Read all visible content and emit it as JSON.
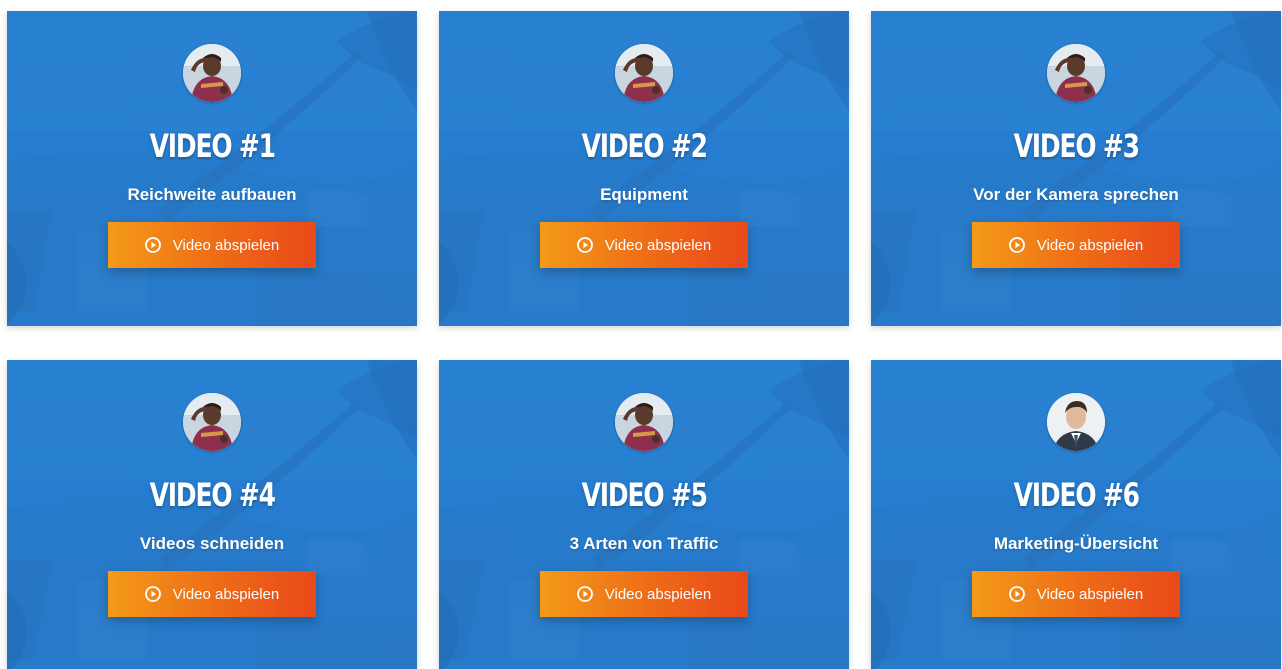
{
  "theme": {
    "card_blue": "#2378c8",
    "button_gradient_start": "#f39a17",
    "button_gradient_end": "#e8491a",
    "text_color": "#ffffff"
  },
  "cards": [
    {
      "title": "VIDEO #1",
      "subtitle": "Reichweite aufbauen",
      "button_label": "Video abspielen",
      "button_icon": "play-circle-icon",
      "avatar": "host-avatar"
    },
    {
      "title": "VIDEO #2",
      "subtitle": "Equipment",
      "button_label": "Video abspielen",
      "button_icon": "play-circle-icon",
      "avatar": "host-avatar"
    },
    {
      "title": "VIDEO #3",
      "subtitle": "Vor der Kamera sprechen",
      "button_label": "Video abspielen",
      "button_icon": "play-circle-icon",
      "avatar": "host-avatar"
    },
    {
      "title": "VIDEO #4",
      "subtitle": "Videos schneiden",
      "button_label": "Video abspielen",
      "button_icon": "play-circle-icon",
      "avatar": "host-avatar"
    },
    {
      "title": "VIDEO #5",
      "subtitle": "3 Arten von Traffic",
      "button_label": "Video abspielen",
      "button_icon": "play-circle-icon",
      "avatar": "host-avatar"
    },
    {
      "title": "VIDEO #6",
      "subtitle": "Marketing-Übersicht",
      "button_label": "Video abspielen",
      "button_icon": "play-circle-icon",
      "avatar": "guest-avatar"
    }
  ]
}
